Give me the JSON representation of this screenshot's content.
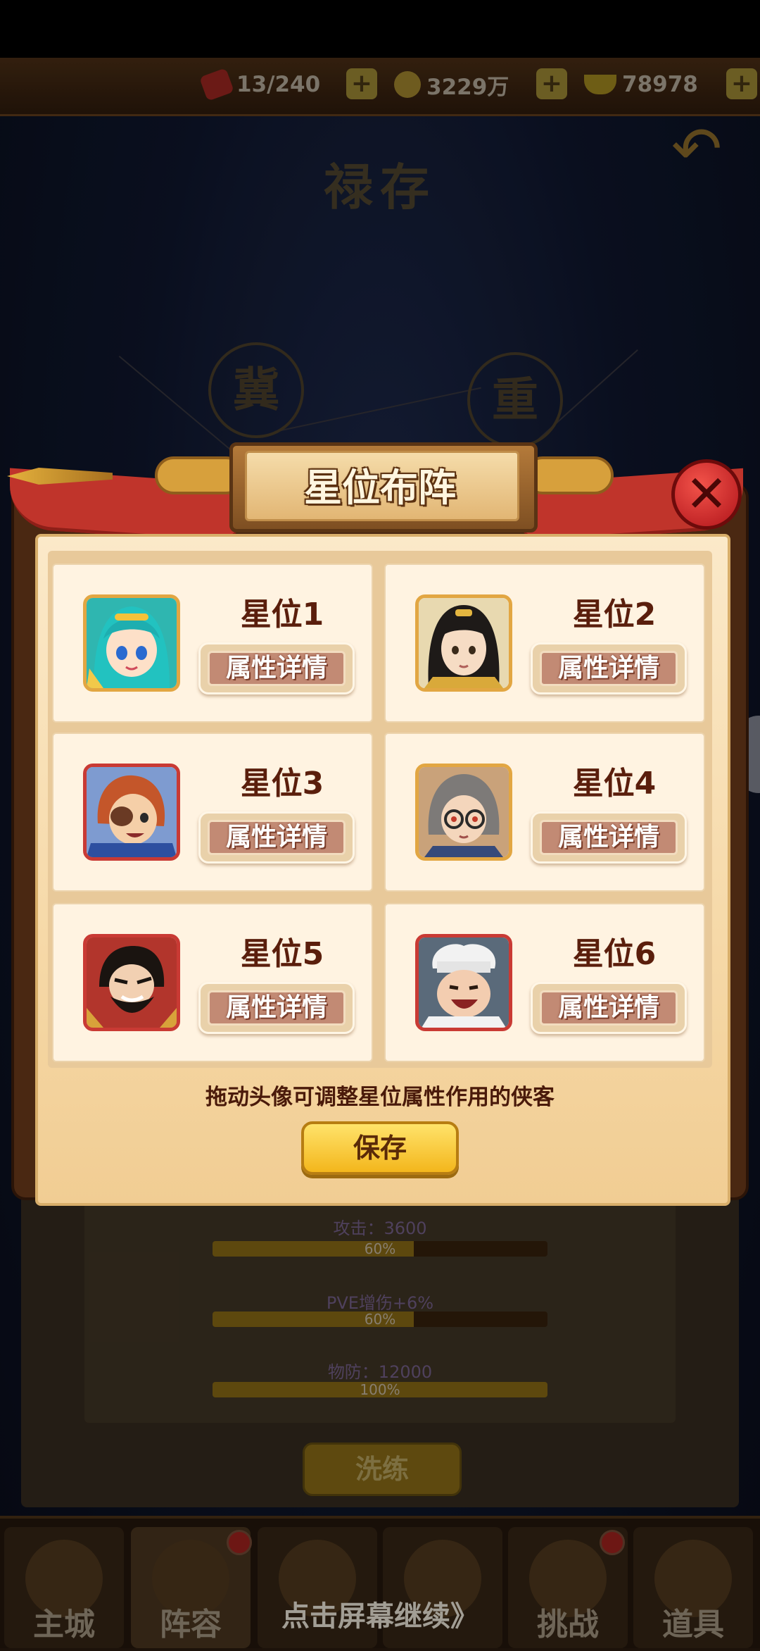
{
  "resources": {
    "stamina": "13/240",
    "coins": "3229万",
    "ingots": "78978"
  },
  "background": {
    "title": "禄存",
    "seal_left": "冀",
    "seal_right": "重",
    "stats": [
      {
        "label": "攻击：3600",
        "progress": 0.6,
        "percent": "60%"
      },
      {
        "label": "PVE增伤+6%",
        "progress": 0.6,
        "percent": "60%"
      },
      {
        "label": "物防：12000",
        "progress": 1.0,
        "percent": "100%"
      }
    ],
    "refine_label": "洗练"
  },
  "modal": {
    "title": "星位布阵",
    "slots": [
      {
        "label": "星位1",
        "button": "属性详情",
        "hero": "blue-haired-girl"
      },
      {
        "label": "星位2",
        "button": "属性详情",
        "hero": "dark-haired-swordsman"
      },
      {
        "label": "星位3",
        "button": "属性详情",
        "hero": "eyepatch-pirate"
      },
      {
        "label": "星位4",
        "button": "属性详情",
        "hero": "glasses-scholar"
      },
      {
        "label": "星位5",
        "button": "属性详情",
        "hero": "bearded-general"
      },
      {
        "label": "星位6",
        "button": "属性详情",
        "hero": "chef"
      }
    ],
    "hint": "拖动头像可调整星位属性作用的侠客",
    "save_label": "保存"
  },
  "bottom_nav": {
    "items": [
      {
        "label": "主城"
      },
      {
        "label": "阵容"
      },
      {
        "label": ""
      },
      {
        "label": ""
      },
      {
        "label": "挑战"
      },
      {
        "label": "道具"
      }
    ]
  },
  "continue_hint": "点击屏幕继续》"
}
